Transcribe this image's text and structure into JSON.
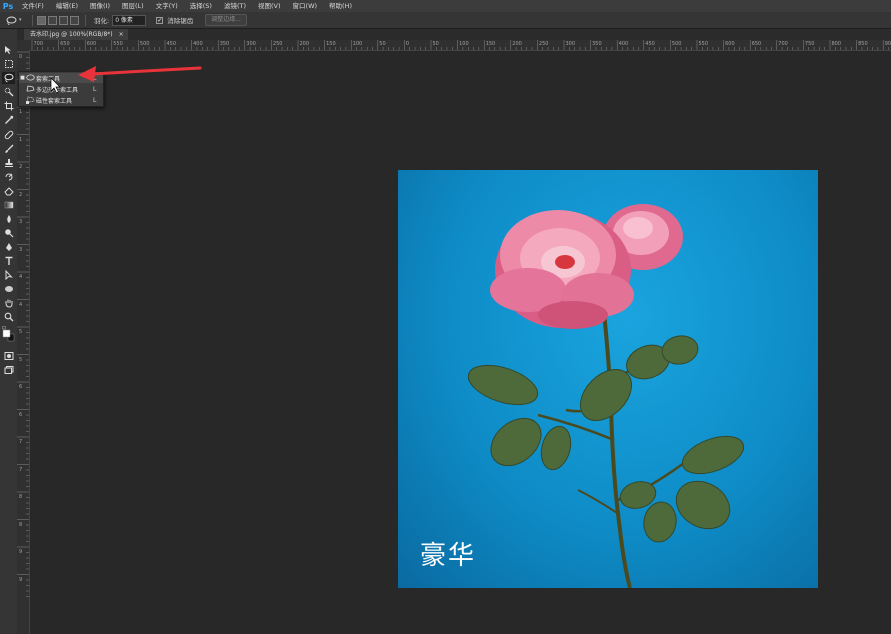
{
  "app": {
    "logo": "Ps"
  },
  "menu": [
    "文件(F)",
    "编辑(E)",
    "图像(I)",
    "图层(L)",
    "文字(Y)",
    "选择(S)",
    "滤镜(T)",
    "视图(V)",
    "窗口(W)",
    "帮助(H)"
  ],
  "options": {
    "feather_label": "羽化:",
    "feather_value": "0 像素",
    "antialias_label": "消除锯齿",
    "refine_button": "调整边缘..."
  },
  "document": {
    "tab_label": "去水印.jpg @ 100%(RGB/8*)",
    "tab_close": "×",
    "watermark_text": "豪华"
  },
  "ruler": {
    "top_labels": [
      "700",
      "650",
      "600",
      "550",
      "500",
      "450",
      "400",
      "350",
      "300",
      "250",
      "200",
      "150",
      "100",
      "50",
      "0",
      "50",
      "100",
      "150",
      "200",
      "250",
      "300",
      "350",
      "400",
      "450",
      "500",
      "550",
      "600",
      "650",
      "700",
      "750",
      "800",
      "850",
      "900"
    ],
    "left_labels": [
      "0",
      "5",
      "1",
      "1",
      "2",
      "2",
      "3",
      "3",
      "4",
      "4",
      "5",
      "5",
      "6",
      "6",
      "7",
      "7",
      "8",
      "8",
      "9",
      "9"
    ]
  },
  "flyout": {
    "items": [
      {
        "label": "套索工具",
        "key": "L",
        "active": true,
        "icon": "lasso-icon"
      },
      {
        "label": "多边形套索工具",
        "key": "L",
        "active": false,
        "icon": "polygonal-lasso-icon"
      },
      {
        "label": "磁性套索工具",
        "key": "L",
        "active": false,
        "icon": "magnetic-lasso-icon"
      }
    ]
  },
  "colors": {
    "accent": "#31a8ff",
    "annotation_arrow": "#e8333a",
    "canvas_bg": "#0e8cc7"
  }
}
